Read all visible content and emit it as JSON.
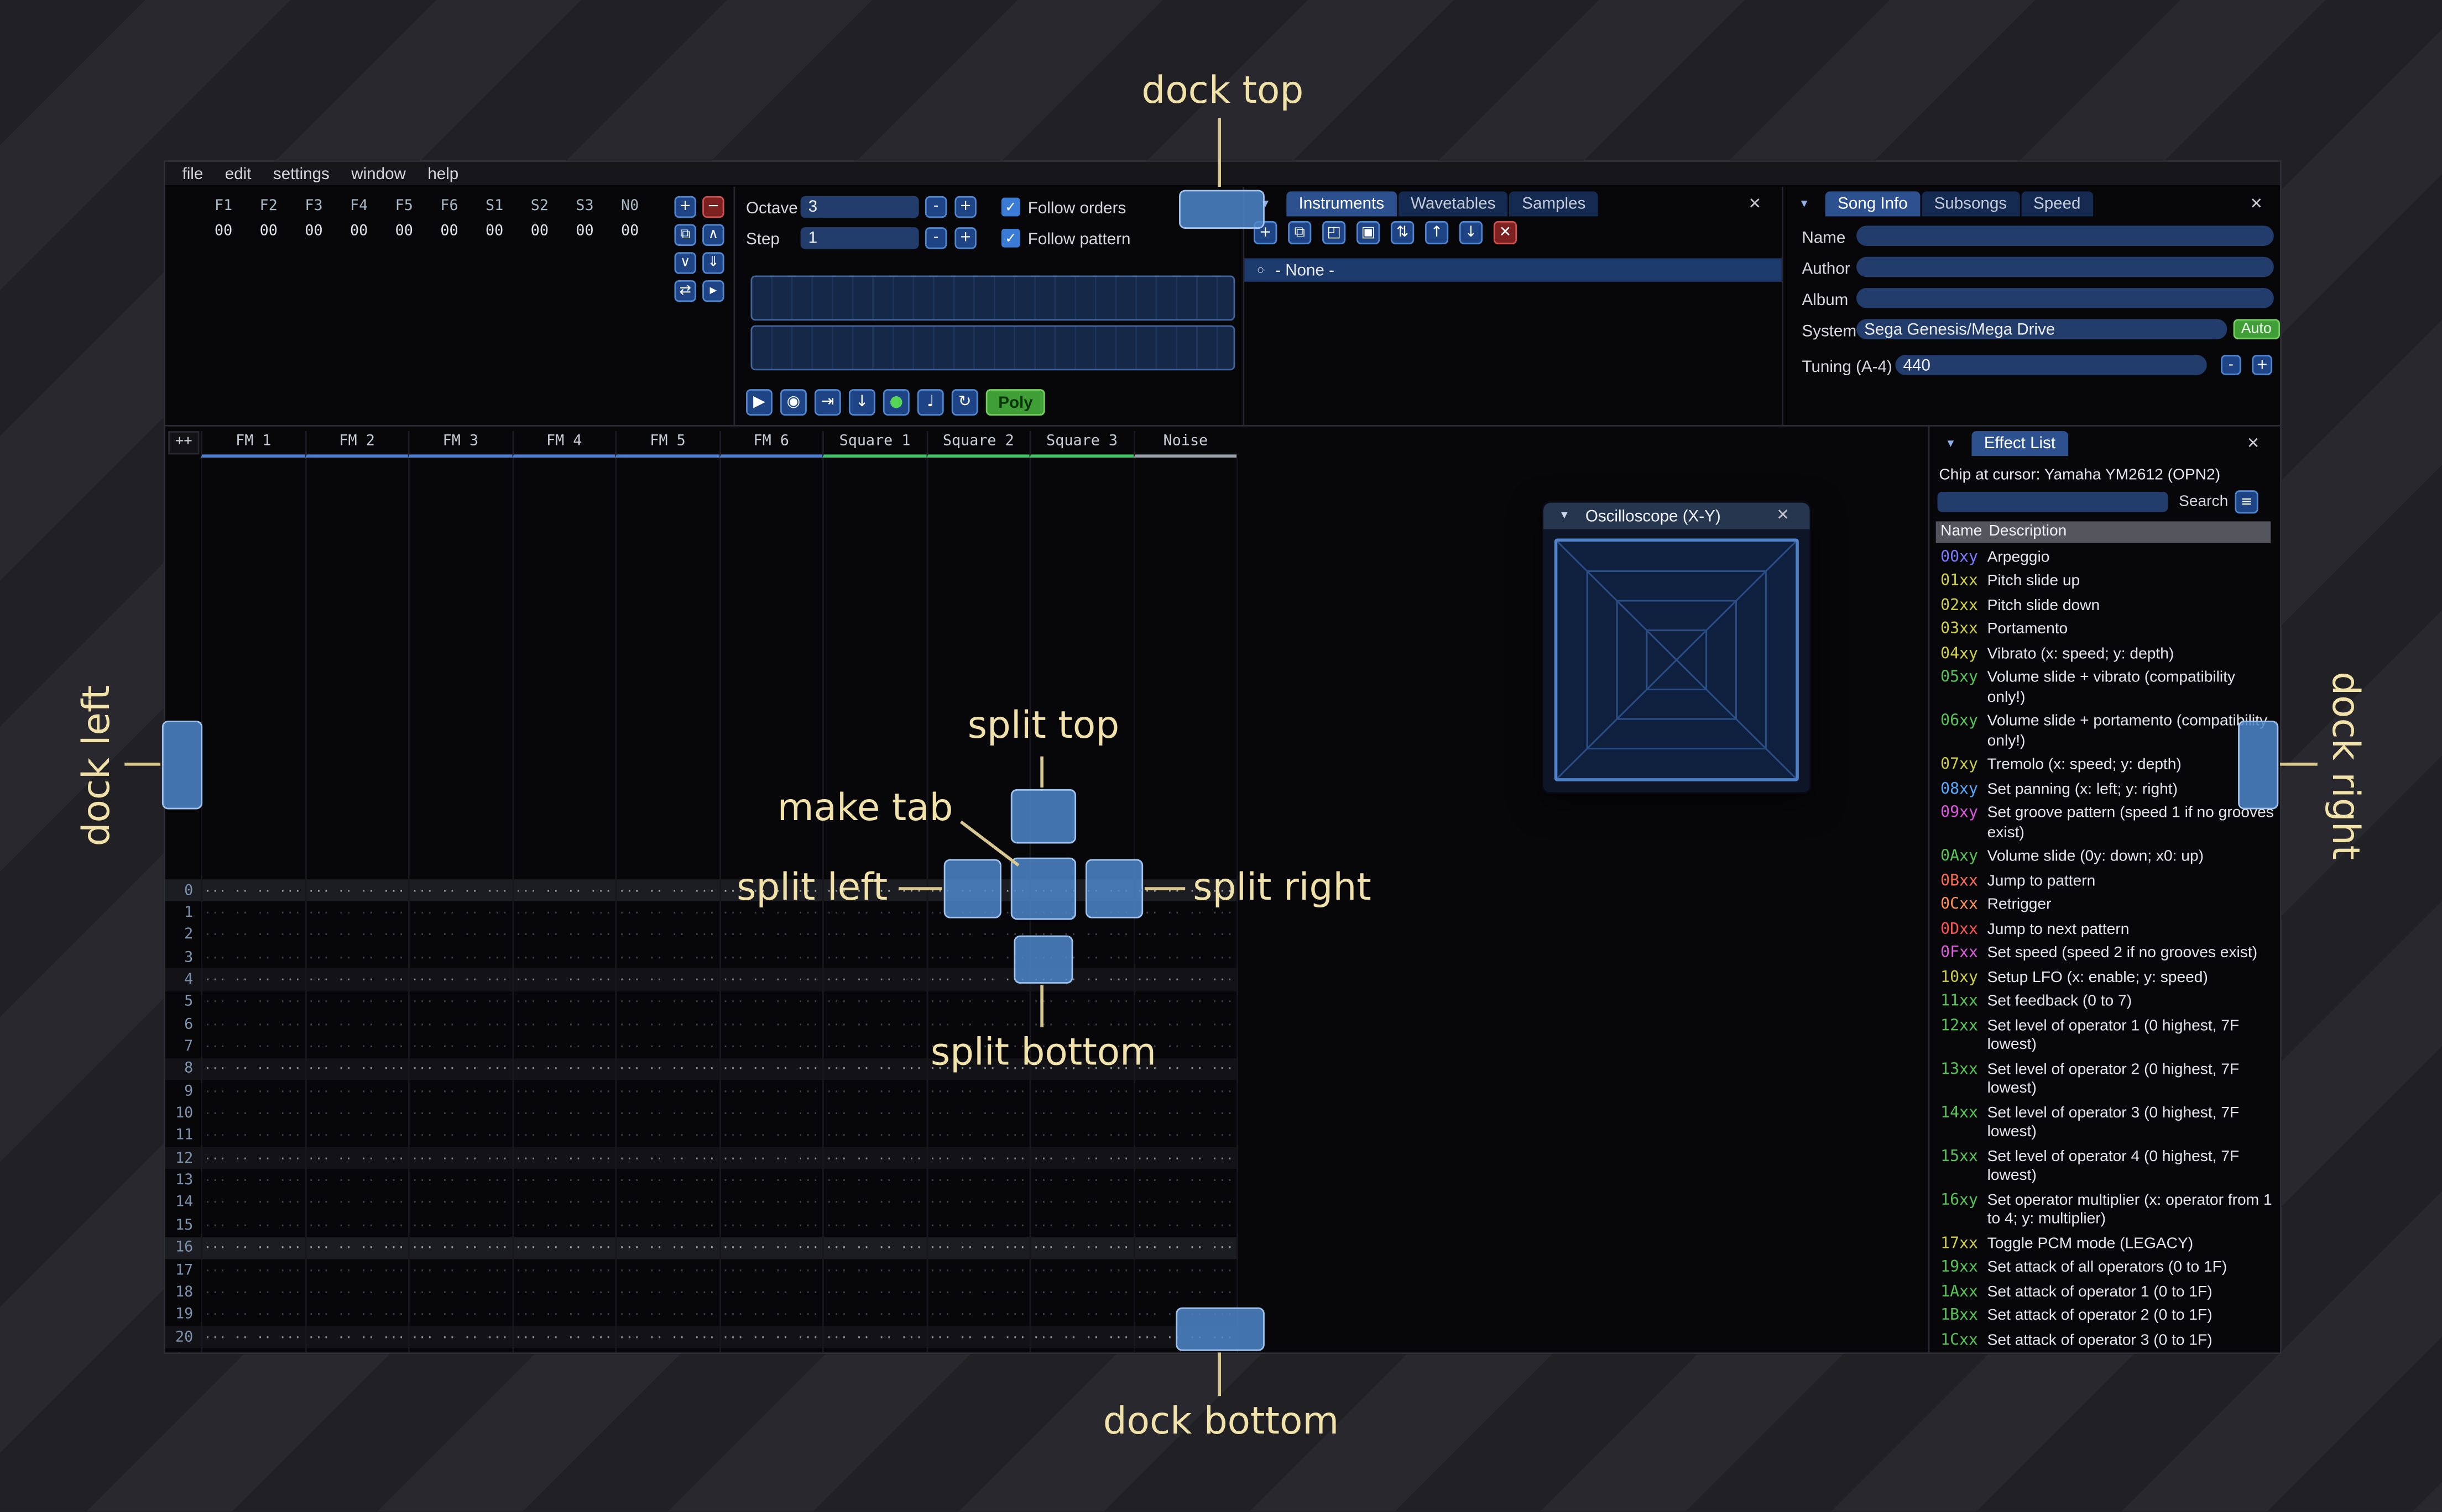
{
  "ui": {
    "close_glyph": "✕",
    "collapse_glyph": "▼",
    "minus": "-",
    "plus": "+",
    "menu_glyph": "≡",
    "check_glyph": "✓"
  },
  "menu": {
    "items": [
      "file",
      "edit",
      "settings",
      "window",
      "help"
    ]
  },
  "orders": {
    "channels": [
      "F1",
      "F2",
      "F3",
      "F4",
      "F5",
      "F6",
      "S1",
      "S2",
      "S3",
      "N0"
    ],
    "row_values": [
      "00",
      "00",
      "00",
      "00",
      "00",
      "00",
      "00",
      "00",
      "00",
      "00"
    ],
    "buttons": [
      {
        "name": "add",
        "glyph": "+",
        "style": "blue"
      },
      {
        "name": "remove",
        "glyph": "−",
        "style": "red"
      },
      {
        "name": "duplicate",
        "glyph": "⧉",
        "style": "blue"
      },
      {
        "name": "move-up",
        "glyph": "∧",
        "style": "blue"
      },
      {
        "name": "move-down",
        "glyph": "∨",
        "style": "blue"
      },
      {
        "name": "duplicate-to-end",
        "glyph": "⇓",
        "style": "blue"
      },
      {
        "name": "change-all",
        "glyph": "⇄",
        "style": "blue"
      },
      {
        "name": "edit-mode",
        "glyph": "▸",
        "style": "blue"
      }
    ]
  },
  "play_controls": {
    "octave_label": "Octave",
    "octave_value": "3",
    "step_label": "Step",
    "step_value": "1",
    "follow_orders": "Follow orders",
    "follow_pattern": "Follow pattern",
    "transport": [
      {
        "name": "play",
        "glyph": "▶",
        "green": false
      },
      {
        "name": "play-pattern",
        "glyph": "◉",
        "green": false
      },
      {
        "name": "play-from-cursor",
        "glyph": "⇥",
        "green": false
      },
      {
        "name": "step-one-row",
        "glyph": "↓",
        "green": false
      },
      {
        "name": "edit-toggle",
        "glyph": "●",
        "green": true
      },
      {
        "name": "metronome",
        "glyph": "♩",
        "green": false
      },
      {
        "name": "repeat-pattern",
        "glyph": "↻",
        "green": false
      }
    ],
    "poly_label": "Poly"
  },
  "instruments": {
    "tabs": [
      "Instruments",
      "Wavetables",
      "Samples"
    ],
    "active_tab": 0,
    "list_bullet": "○",
    "toolbar": [
      {
        "name": "add",
        "glyph": "+",
        "style": "blue"
      },
      {
        "name": "duplicate",
        "glyph": "⧉",
        "style": "blue"
      },
      {
        "name": "open",
        "glyph": "◰",
        "style": "blue"
      },
      {
        "name": "save",
        "glyph": "▣",
        "style": "blue"
      },
      {
        "name": "toggle-folders",
        "glyph": "⇅",
        "style": "blue"
      },
      {
        "name": "move-up",
        "glyph": "↑",
        "style": "blue"
      },
      {
        "name": "move-down",
        "glyph": "↓",
        "style": "blue"
      },
      {
        "name": "delete",
        "glyph": "✕",
        "style": "red"
      }
    ],
    "list": [
      {
        "label": "- None -",
        "selected": true
      }
    ]
  },
  "song_info": {
    "tabs": [
      "Song Info",
      "Subsongs",
      "Speed"
    ],
    "active_tab": 0,
    "fields": [
      {
        "label": "Name",
        "value": ""
      },
      {
        "label": "Author",
        "value": ""
      },
      {
        "label": "Album",
        "value": ""
      }
    ],
    "system_label": "System",
    "system_value": "Sega Genesis/Mega Drive",
    "auto_label": "Auto",
    "tuning_label": "Tuning (A-4)",
    "tuning_value": "440"
  },
  "pattern": {
    "corner": "++",
    "channels": [
      {
        "name": "FM 1",
        "type": "fm"
      },
      {
        "name": "FM 2",
        "type": "fm"
      },
      {
        "name": "FM 3",
        "type": "fm"
      },
      {
        "name": "FM 4",
        "type": "fm"
      },
      {
        "name": "FM 5",
        "type": "fm"
      },
      {
        "name": "FM 6",
        "type": "fm"
      },
      {
        "name": "Square 1",
        "type": "square"
      },
      {
        "name": "Square 2",
        "type": "square"
      },
      {
        "name": "Square 3",
        "type": "square"
      },
      {
        "name": "Noise",
        "type": "noise"
      }
    ],
    "type_colors": {
      "fm": "#4f7fd0",
      "square": "#3fc46a",
      "noise": "#9aa0a8"
    },
    "rows_visible": 22,
    "empty_cell": "··· ·· ·· ···"
  },
  "oscilloscope": {
    "title": "Oscilloscope (X-Y)"
  },
  "effect_list": {
    "tab": "Effect List",
    "chip_line": "Chip at cursor: Yamaha YM2612 (OPN2)",
    "search_label": "Search",
    "search_value": "",
    "header_name": "Name",
    "header_desc": "Description",
    "effects": [
      {
        "code": "00xy",
        "color": "#7a7aff",
        "desc": "Arpeggio"
      },
      {
        "code": "01xx",
        "color": "#cfcf45",
        "desc": "Pitch slide up"
      },
      {
        "code": "02xx",
        "color": "#cfcf45",
        "desc": "Pitch slide down"
      },
      {
        "code": "03xx",
        "color": "#cfcf45",
        "desc": "Portamento"
      },
      {
        "code": "04xy",
        "color": "#cfcf45",
        "desc": "Vibrato (x: speed; y: depth)"
      },
      {
        "code": "05xy",
        "color": "#55c455",
        "desc": "Volume slide + vibrato (compatibility only!)"
      },
      {
        "code": "06xy",
        "color": "#55c455",
        "desc": "Volume slide + portamento (compatibility only!)"
      },
      {
        "code": "07xy",
        "color": "#cfcf45",
        "desc": "Tremolo (x: speed; y: depth)"
      },
      {
        "code": "08xy",
        "color": "#55aaff",
        "desc": "Set panning (x: left; y: right)"
      },
      {
        "code": "09xy",
        "color": "#e055e0",
        "desc": "Set groove pattern (speed 1 if no grooves exist)"
      },
      {
        "code": "0Axy",
        "color": "#55c455",
        "desc": "Volume slide (0y: down; x0: up)"
      },
      {
        "code": "0Bxx",
        "color": "#ff6b52",
        "desc": "Jump to pattern"
      },
      {
        "code": "0Cxx",
        "color": "#ff9152",
        "desc": "Retrigger"
      },
      {
        "code": "0Dxx",
        "color": "#ff5252",
        "desc": "Jump to next pattern"
      },
      {
        "code": "0Fxx",
        "color": "#de5ade",
        "desc": "Set speed (speed 2 if no grooves exist)"
      },
      {
        "code": "10xy",
        "color": "#cfcf45",
        "desc": "Setup LFO (x: enable; y: speed)"
      },
      {
        "code": "11xx",
        "color": "#55c455",
        "desc": "Set feedback (0 to 7)"
      },
      {
        "code": "12xx",
        "color": "#55c455",
        "desc": "Set level of operator 1 (0 highest, 7F lowest)"
      },
      {
        "code": "13xx",
        "color": "#55c455",
        "desc": "Set level of operator 2 (0 highest, 7F lowest)"
      },
      {
        "code": "14xx",
        "color": "#55c455",
        "desc": "Set level of operator 3 (0 highest, 7F lowest)"
      },
      {
        "code": "15xx",
        "color": "#55c455",
        "desc": "Set level of operator 4 (0 highest, 7F lowest)"
      },
      {
        "code": "16xy",
        "color": "#55c455",
        "desc": "Set operator multiplier (x: operator from 1 to 4; y: multiplier)"
      },
      {
        "code": "17xx",
        "color": "#cfcf45",
        "desc": "Toggle PCM mode (LEGACY)"
      },
      {
        "code": "19xx",
        "color": "#55c455",
        "desc": "Set attack of all operators (0 to 1F)"
      },
      {
        "code": "1Axx",
        "color": "#55c455",
        "desc": "Set attack of operator 1 (0 to 1F)"
      },
      {
        "code": "1Bxx",
        "color": "#55c455",
        "desc": "Set attack of operator 2 (0 to 1F)"
      },
      {
        "code": "1Cxx",
        "color": "#55c455",
        "desc": "Set attack of operator 3 (0 to 1F)"
      }
    ]
  },
  "annotations": {
    "dock_top": "dock top",
    "dock_bottom": "dock bottom",
    "dock_left": "dock left",
    "dock_right": "dock right",
    "split_top": "split top",
    "split_bottom": "split bottom",
    "split_left": "split left",
    "split_right": "split right",
    "make_tab": "make tab",
    "label_color": "#f1e2a9",
    "line_color": "#d8c78e",
    "indicator_fill": "#4e86c9",
    "indicator_border": "#9fc3ee"
  }
}
